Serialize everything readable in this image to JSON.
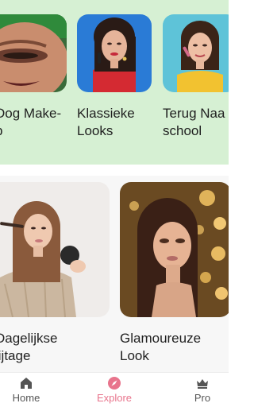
{
  "categories": [
    {
      "label": "Dog Make-\np",
      "image": "smokey-eye-closeup-photo"
    },
    {
      "label": "Klassieke\nLooks",
      "image": "woman-red-top-photo"
    },
    {
      "label": "Terug Naa\nschool",
      "image": "woman-yellow-top-photo"
    }
  ],
  "featured": [
    {
      "label": "Dagelijkse\nlijtage",
      "image": "woman-applying-makeup-photo"
    },
    {
      "label": "Glamoureuze\nLook",
      "image": "glamour-gold-background-photo"
    }
  ],
  "nav": {
    "items": [
      {
        "label": "Home",
        "icon": "home-icon",
        "active": false
      },
      {
        "label": "Explore",
        "icon": "compass-icon",
        "active": true
      },
      {
        "label": "Pro",
        "icon": "crown-icon",
        "active": false
      }
    ]
  },
  "colors": {
    "top_band": "#d6f0d3",
    "accent": "#e8748c",
    "nav_inactive": "#555555"
  }
}
